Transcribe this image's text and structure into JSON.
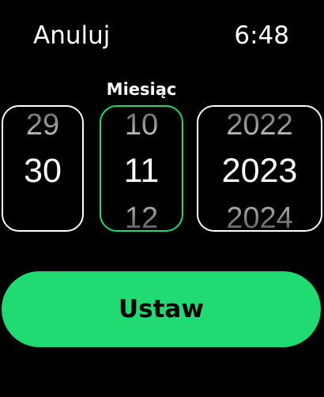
{
  "header": {
    "cancel_label": "Anuluj",
    "time": "6:48"
  },
  "picker": {
    "selected_label": "Miesiąc",
    "accent_color": "#1fdb72",
    "day": {
      "above": "29",
      "value": "30"
    },
    "month": {
      "above": "10",
      "value": "11",
      "below": "12"
    },
    "year": {
      "above": "2022",
      "value": "2023",
      "below": "2024"
    }
  },
  "action": {
    "set_label": "Ustaw"
  }
}
